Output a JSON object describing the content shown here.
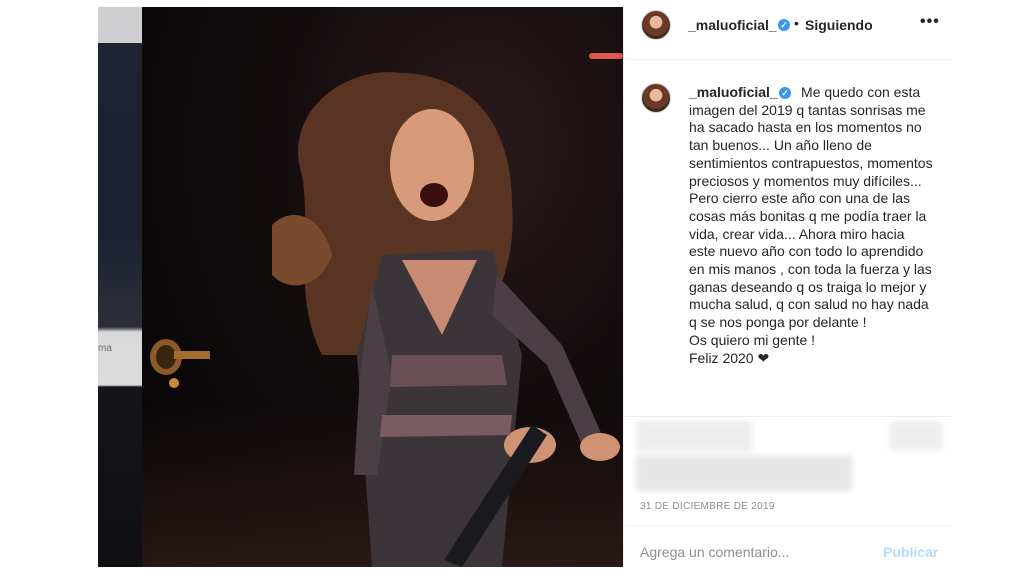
{
  "post": {
    "username": "_maluoficial_",
    "follow_status": "Siguiendo",
    "separator": "•",
    "more_label": "•••",
    "verified_mark": "✓",
    "caption": "Me quedo con esta imagen del 2019 q tantas sonrisas me ha sacado hasta en los momentos no tan buenos... Un año lleno de sentimientos contrapuestos, momentos preciosos y momentos muy difíciles...\nPero cierro este año con una de las cosas más bonitas q me podía traer la vida, crear vida... Ahora miro hacia este nuevo año con todo lo aprendido en mis manos , con toda la fuerza y las ganas deseando q os traiga lo mejor y mucha salud, q con salud no hay nada q se nos ponga por delante !\nOs quiero mi gente !\nFeliz 2020 ❤",
    "date": "31 DE DICIEMBRE DE 2019"
  },
  "comment_box": {
    "placeholder": "Agrega un comentario...",
    "publish_label": "Publicar"
  },
  "side_strip": {
    "text": "ma"
  },
  "colors": {
    "verified": "#3897f0",
    "publish_disabled": "#b3dbff",
    "muted": "#8e8e8e"
  }
}
